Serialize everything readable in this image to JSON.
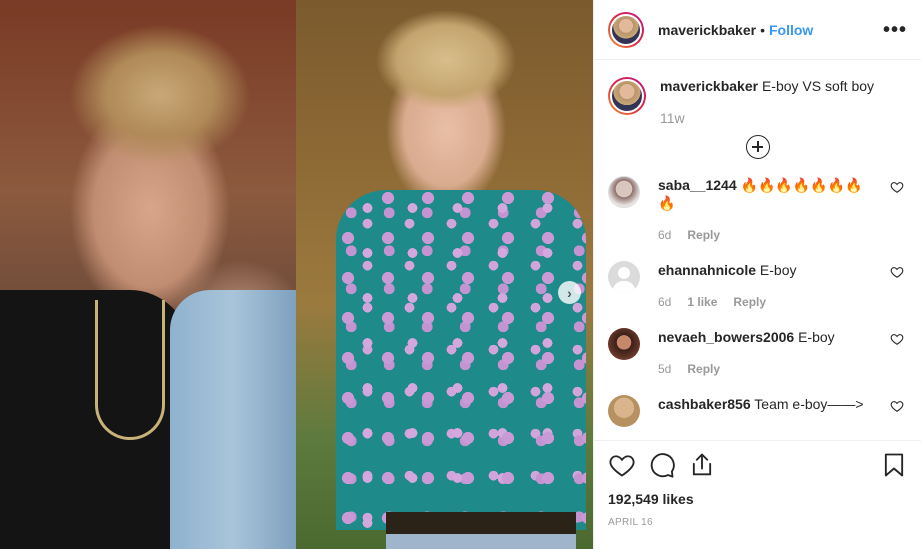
{
  "post": {
    "username": "maverickbaker",
    "separator": "•",
    "follow_label": "Follow",
    "more_label": "•••",
    "caption_text": "E-boy VS soft boy",
    "caption_time": "11w",
    "likes": "192,549 likes",
    "date": "APRIL 16",
    "media_next_arrow": "›"
  },
  "comments": [
    {
      "username": "saba__1244",
      "text": "🔥🔥🔥🔥🔥🔥🔥🔥",
      "time": "6d",
      "likes": "",
      "reply": "Reply",
      "avatar": "cav-1"
    },
    {
      "username": "ehannahnicole",
      "text": "E-boy",
      "time": "6d",
      "likes": "1 like",
      "reply": "Reply",
      "avatar": "cav-2"
    },
    {
      "username": "nevaeh_bowers2006",
      "text": "E-boy",
      "time": "5d",
      "likes": "",
      "reply": "Reply",
      "avatar": "cav-3"
    },
    {
      "username": "cashbaker856",
      "text": "Team e-boy——>",
      "time": "",
      "likes": "",
      "reply": "",
      "avatar": "cav-4"
    }
  ],
  "icons": {
    "like": "heart-icon",
    "comment": "comment-icon",
    "share": "share-icon",
    "save": "bookmark-icon",
    "load_more": "plus-circle-icon"
  }
}
